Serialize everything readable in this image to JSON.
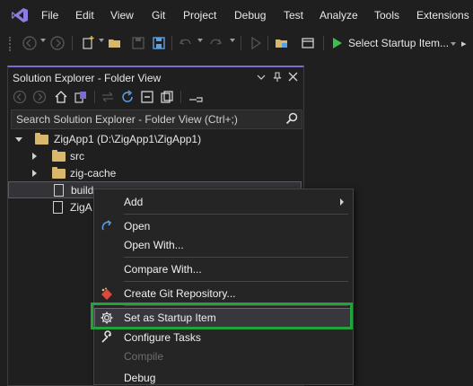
{
  "menubar": {
    "items": [
      "File",
      "Edit",
      "View",
      "Git",
      "Project",
      "Debug",
      "Test",
      "Analyze",
      "Tools",
      "Extensions"
    ]
  },
  "toolbar": {
    "startup_label": "Select Startup Item..."
  },
  "explorer": {
    "title": "Solution Explorer - Folder View",
    "search_placeholder": "Search Solution Explorer - Folder View (Ctrl+;)",
    "tree": [
      {
        "label": "ZigApp1 (D:\\ZigApp1\\ZigApp1)",
        "type": "folder",
        "expanded": true
      },
      {
        "label": "src",
        "type": "folder",
        "expanded": false
      },
      {
        "label": "zig-cache",
        "type": "folder",
        "expanded": false
      },
      {
        "label": "build",
        "type": "file",
        "selected": true
      },
      {
        "label": "ZigA",
        "type": "file"
      }
    ]
  },
  "context_menu": {
    "items": [
      {
        "label": "Add",
        "icon": "none",
        "submenu": true
      },
      {
        "label": "Open",
        "icon": "open-arrow-icon"
      },
      {
        "label": "Open With...",
        "icon": "none"
      },
      {
        "label": "Compare With...",
        "icon": "none"
      },
      {
        "label": "Create Git Repository...",
        "icon": "git-icon"
      },
      {
        "label": "Set as Startup Item",
        "icon": "gear-icon",
        "highlighted": true
      },
      {
        "label": "Configure Tasks",
        "icon": "wrench-icon"
      },
      {
        "label": "Compile",
        "icon": "none",
        "disabled": true
      },
      {
        "label": "Debug",
        "icon": "none"
      }
    ]
  },
  "colors": {
    "accent_purple": "#7a6bd6",
    "highlight_green": "#22a33c",
    "play_green": "#3bbf4f",
    "folder": "#d8b86a"
  }
}
